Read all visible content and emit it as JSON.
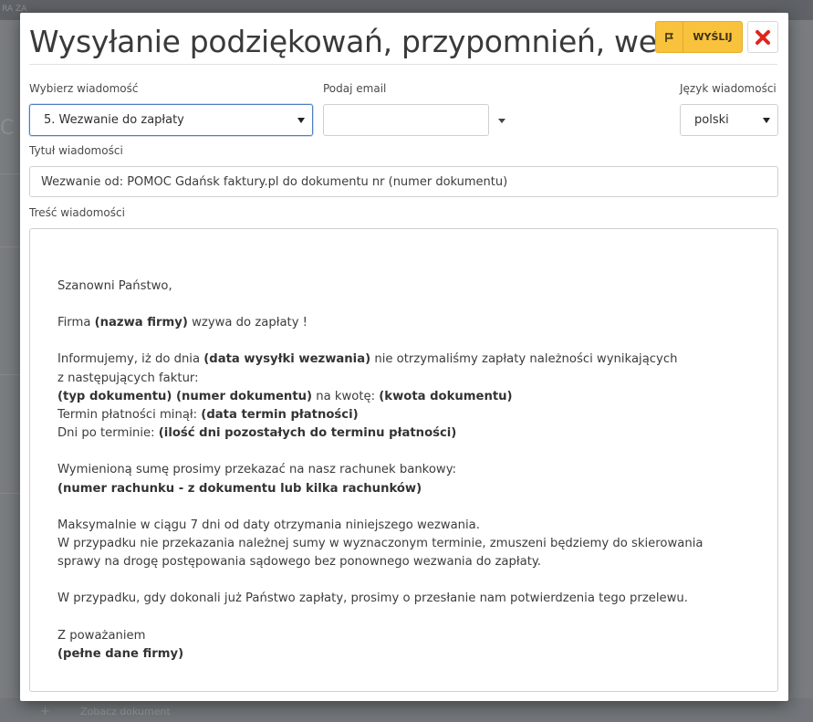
{
  "background": {
    "topbar_left": "RA ZA",
    "bottom_button": "Zobacz dokument"
  },
  "modal": {
    "title": "Wysyłanie podziękowań, przypomnień, wezwań",
    "send_button": {
      "label": "WYŚLIJ",
      "icon": "send-icon"
    },
    "close_button": {
      "icon": "close-icon",
      "color": "#e0251b"
    },
    "accent_color": "#f9c23c"
  },
  "form": {
    "message_select": {
      "label": "Wybierz wiadomość",
      "value": "5. Wezwanie do zapłaty"
    },
    "email": {
      "label": "Podaj email",
      "value": ""
    },
    "language": {
      "label": "Język wiadomości",
      "value": "polski"
    },
    "subject": {
      "label": "Tytuł wiadomości",
      "value": "Wezwanie od: POMOC Gdańsk faktury.pl do dokumentu nr (numer dokumentu)"
    },
    "body_label": "Treść wiadomości"
  },
  "body": {
    "greeting": "Szanowni Państwo,",
    "p1_pre": "Firma ",
    "p1_bold": "(nazwa firmy)",
    "p1_post": " wzywa do zapłaty !",
    "p2_pre": "Informujemy, iż do dnia ",
    "p2_bold": "(data wysyłki wezwania)",
    "p2_post": " nie otrzymaliśmy zapłaty należności wynikających",
    "p2_line2": "z następujących faktur:",
    "doc_bold1": "(typ dokumentu) (numer dokumentu)",
    "doc_mid": " na kwotę: ",
    "doc_bold2": "(kwota dokumentu)",
    "term_pre": "Termin płatności minął: ",
    "term_bold": "(data termin płatności)",
    "days_pre": "Dni po terminie: ",
    "days_bold": "(ilość dni pozostałych do terminu płatności)",
    "p3": "Wymienioną sumę prosimy przekazać na nasz rachunek bankowy:",
    "p3_bold": "(numer rachunku - z dokumentu lub kilka rachunków)",
    "p4_l1": "Maksymalnie w ciągu 7 dni od daty otrzymania niniejszego wezwania.",
    "p4_l2": "W przypadku nie przekazania należnej sumy w wyznaczonym terminie, zmuszeni będziemy do skierowania",
    "p4_l3": "sprawy na drogę postępowania sądowego bez ponownego wezwania do zapłaty.",
    "p5": "W przypadku, gdy dokonali już Państwo zapłaty, prosimy o przesłanie nam potwierdzenia tego przelewu.",
    "closing": "Z poważaniem",
    "closing_bold": "(pełne dane firmy)"
  }
}
